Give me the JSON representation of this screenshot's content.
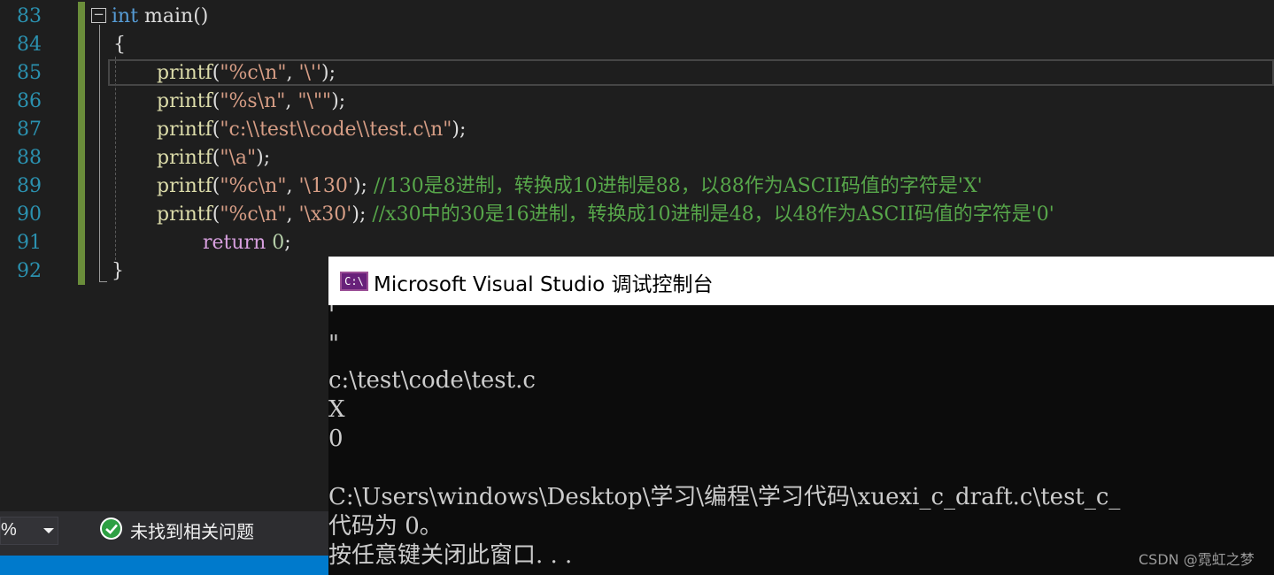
{
  "editor": {
    "line_numbers": [
      "83",
      "84",
      "85",
      "86",
      "87",
      "88",
      "89",
      "90",
      "91",
      "92"
    ],
    "lines": {
      "l83": {
        "kw": "int",
        "rest": " main()"
      },
      "l84": {
        "text": "{"
      },
      "l85": {
        "fn": "printf",
        "p1": "(",
        "str": "\"%c\\n\"",
        "p2": ", ",
        "str2": "'\\''",
        "end": ");"
      },
      "l86": {
        "fn": "printf",
        "p1": "(",
        "str": "\"%s\\n\"",
        "p2": ", ",
        "str2": "\"\\\"\"",
        "end": ");"
      },
      "l87": {
        "fn": "printf",
        "p1": "(",
        "str": "\"c:\\\\test\\\\code\\\\test.c\\n\"",
        "end": ");"
      },
      "l88": {
        "fn": "printf",
        "p1": "(",
        "str": "\"\\a\"",
        "end": ");"
      },
      "l89": {
        "fn": "printf",
        "p1": "(",
        "str": "\"%c\\n\"",
        "p2": ", ",
        "str2": "'\\130'",
        "end": "); ",
        "cmt": "//130是8进制，转换成10进制是88，以88作为ASCII码值的字符是'X'"
      },
      "l90": {
        "fn": "printf",
        "p1": "(",
        "str": "\"%c\\n\"",
        "p2": ", ",
        "str2": "'\\x30'",
        "end": "); ",
        "cmt": "//x30中的30是16进制，转换成10进制是48，以48作为ASCII码值的字符是'0'"
      },
      "l91": {
        "kw": "return",
        "num": "0",
        "end": ";"
      },
      "l92": {
        "text": "}"
      }
    },
    "fold_glyph": "−"
  },
  "status_bar": {
    "zoom_value": "%",
    "issues_text": "未找到相关问题",
    "issues_icon": "check-circle-icon"
  },
  "console": {
    "title": "Microsoft Visual Studio 调试控制台",
    "icon_text": "C:\\",
    "output": [
      "'",
      "\"",
      "c:\\test\\code\\test.c",
      "X",
      "0",
      "",
      "C:\\Users\\windows\\Desktop\\学习\\编程\\学习代码\\xuexi_c_draft.c\\test_c_",
      "代码为 0。",
      "按任意键关闭此窗口. . ."
    ],
    "watermark": "CSDN @霓虹之梦"
  },
  "colors": {
    "editor_bg": "#1e1e1e",
    "keyword": "#569cd6",
    "function": "#dcdcaa",
    "string": "#d69d85",
    "comment": "#57a64a",
    "line_number": "#2b91af",
    "change_bar": "#6a8d3a",
    "status_blue": "#007acc"
  }
}
